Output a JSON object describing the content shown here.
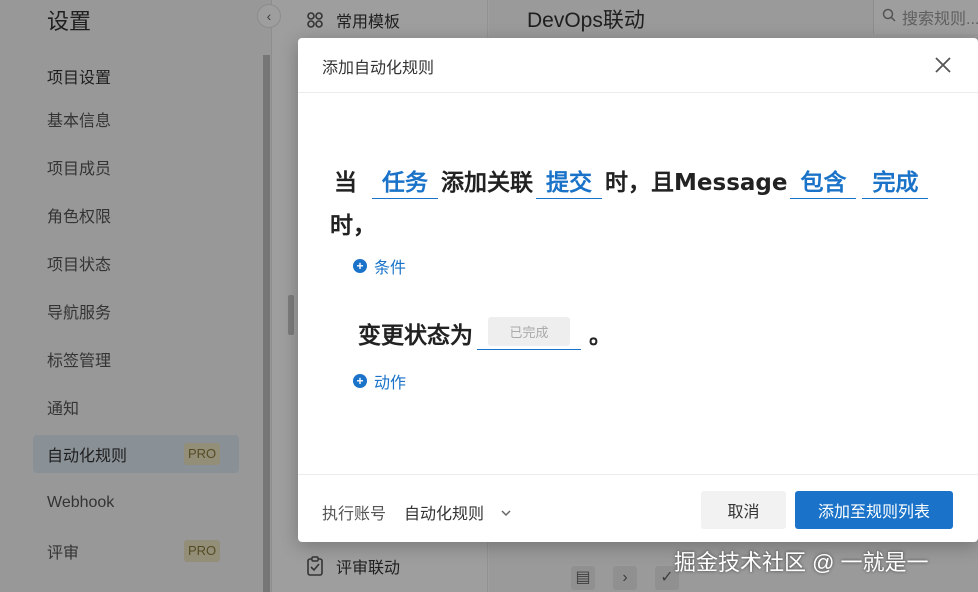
{
  "sidebar": {
    "title": "设置",
    "collapse_icon": "chevron-left-icon",
    "section_title": "项目设置",
    "items": [
      {
        "label": "基本信息"
      },
      {
        "label": "项目成员"
      },
      {
        "label": "角色权限"
      },
      {
        "label": "项目状态"
      },
      {
        "label": "导航服务"
      },
      {
        "label": "标签管理"
      },
      {
        "label": "通知"
      },
      {
        "label": "自动化规则",
        "badge": "PRO",
        "active": true
      },
      {
        "label": "Webhook"
      },
      {
        "label": "评审",
        "badge": "PRO"
      }
    ]
  },
  "middle": {
    "top_item": {
      "label": "常用模板",
      "icon": "grid-icon"
    },
    "bottom_item": {
      "label": "评审联动",
      "icon": "clipboard-icon"
    }
  },
  "content": {
    "title": "DevOps联动",
    "search_placeholder": "搜索规则..."
  },
  "modal": {
    "title": "添加自动化规则",
    "rule": {
      "prefix": "当",
      "object": "任务",
      "verb": "添加关联",
      "target": "提交",
      "mid": "时，且Message",
      "operator": "包含",
      "value": "完成",
      "suffix": "时，"
    },
    "add_condition": "条件",
    "action": {
      "prefix": "变更状态为",
      "status": "已完成",
      "suffix": "。"
    },
    "add_action": "动作",
    "footer": {
      "exec_label": "执行账号",
      "exec_value": "自动化规则",
      "cancel": "取消",
      "submit": "添加至规则列表"
    }
  },
  "watermark": "掘金技术社区 @ 一就是一",
  "colors": {
    "accent": "#1a73c8",
    "overlay": "rgba(0,0,0,0.38)",
    "active_nav": "#dde8f3",
    "pro_badge_bg": "#eee6c2"
  }
}
